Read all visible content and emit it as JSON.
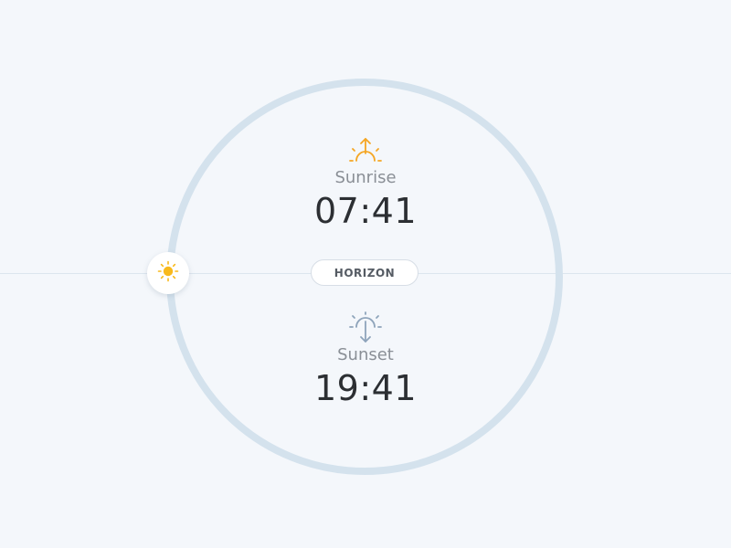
{
  "horizon": {
    "label": "HORIZON"
  },
  "sunrise": {
    "label": "Sunrise",
    "time": "07:41",
    "icon": "sunrise-icon",
    "color": "#f5a623"
  },
  "sunset": {
    "label": "Sunset",
    "time": "19:41",
    "icon": "sunset-icon",
    "color": "#8ea4bb"
  },
  "sun_marker": {
    "icon": "sun-icon",
    "color": "#f8b91c"
  },
  "colors": {
    "background": "#f4f7fb",
    "orbit": "#d4e2ed",
    "horizon_line": "#dce5ee"
  }
}
